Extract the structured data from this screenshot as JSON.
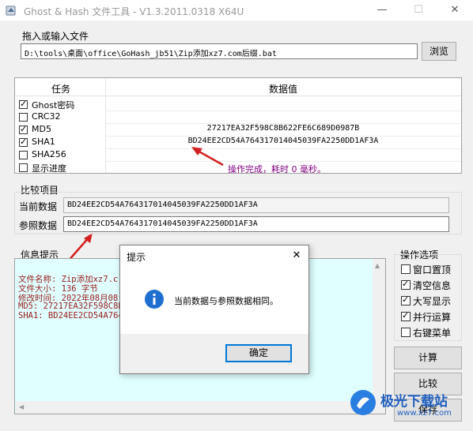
{
  "window": {
    "title": "Ghost & Hash 文件工具 - V1.3.2011.0318 X64U",
    "minimize": "—",
    "maximize": "☐",
    "close": "✕"
  },
  "file": {
    "section_label": "拖入或输入文件",
    "path": "D:\\tools\\桌面\\office\\GoHash_jb51\\Zip添加xz7.com后缀.bat",
    "browse_label": "浏览"
  },
  "hash_table": {
    "header_task": "任务",
    "header_value": "数据值",
    "rows": [
      {
        "label": "Ghost密码",
        "checked": true,
        "value": ""
      },
      {
        "label": "CRC32",
        "checked": false,
        "value": ""
      },
      {
        "label": "MD5",
        "checked": true,
        "value": "27217EA32F598C8B622FE6C689D0987B"
      },
      {
        "label": "SHA1",
        "checked": true,
        "value": "BD24EE2CD54A764317014045039FA2250DD1AF3A"
      },
      {
        "label": "SHA256",
        "checked": false,
        "value": ""
      },
      {
        "label": "显示进度",
        "checked": false,
        "value": "操作完成，耗时 0 毫秒。"
      }
    ]
  },
  "compare": {
    "section_label": "比较项目",
    "current_label": "当前数据",
    "current_value": "BD24EE2CD54A764317014045039FA2250DD1AF3A",
    "reference_label": "参照数据",
    "reference_value": "BD24EE2CD54A764317014045039FA2250DD1AF3A"
  },
  "info": {
    "section_label": "信息提示",
    "lines": [
      "文件名称: Zip添加xz7.c",
      "文件大小: 136 字节",
      "修改时间: 2022年08月08",
      "MD5: 27217EA32F598C8B6",
      "SHA1: BD24EE2CD54A7643"
    ]
  },
  "options": {
    "section_label": "操作选项",
    "items": [
      {
        "label": "窗口置顶",
        "checked": false
      },
      {
        "label": "清空信息",
        "checked": true
      },
      {
        "label": "大写显示",
        "checked": true
      },
      {
        "label": "并行运算",
        "checked": true
      },
      {
        "label": "右键菜单",
        "checked": false
      }
    ],
    "calc_label": "计算",
    "compare_label": "比较",
    "save_label": "保存"
  },
  "dialog": {
    "title": "提示",
    "close": "✕",
    "message": "当前数据与参照数据相同。",
    "ok_label": "确定"
  },
  "watermark": {
    "text": "极光下载站",
    "url": "www.xz7.com"
  },
  "colors": {
    "accent": "#0078d7",
    "info_bg": "#e0ffff",
    "info_text": "#9a1a1a",
    "status_text": "#800080",
    "arrow": "#d42020"
  }
}
